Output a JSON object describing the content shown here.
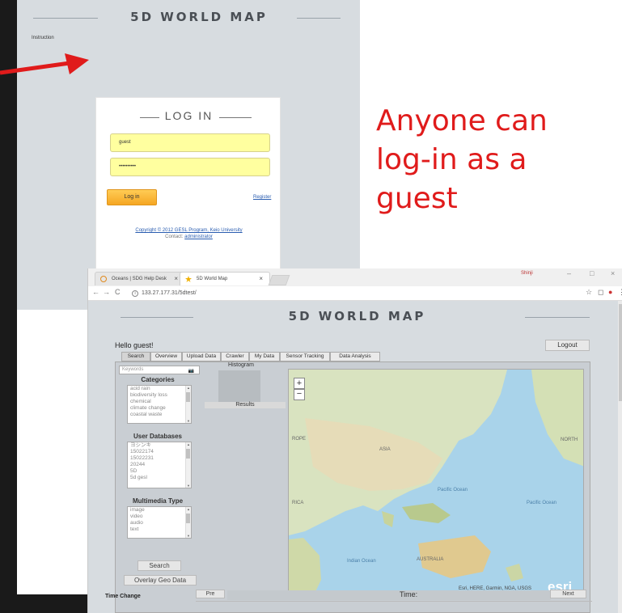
{
  "login_page": {
    "title": "5D WORLD MAP",
    "instruction": "Instruction",
    "heading": "LOG IN",
    "username_value": "guest",
    "password_value": "••••••••••",
    "login_button": "Log in",
    "register_link": "Register",
    "copyright": "Copyright © 2012  GESL Program, Keio University",
    "contact_label": "Contact:",
    "contact_link": "administrator"
  },
  "annotation": {
    "line1": "Anyone can",
    "line2": "log-in as a",
    "line3": "guest",
    "color": "#e01b1b"
  },
  "browser": {
    "tabs": [
      {
        "label": "Oceans | SDG Help Desk"
      },
      {
        "label": "5D World Map"
      }
    ],
    "url": "133.27.177.31/5dtest/",
    "window_user": "Shinji"
  },
  "app": {
    "title": "5D WORLD MAP",
    "greeting": "Hello guest!",
    "logout": "Logout",
    "tabs": [
      "Search",
      "Overview",
      "Upload Data",
      "Crawler",
      "My Data",
      "Sensor Tracking",
      "Data Analysis"
    ],
    "keywords_placeholder": "Keywords",
    "categories": {
      "heading": "Categories",
      "items": [
        "acid rain",
        "biodiversity loss",
        "chemical",
        "climate change",
        "coastal waste"
      ]
    },
    "user_databases": {
      "heading": "User Databases",
      "items": [
        "ヨシンキ",
        "15022174",
        "15022231",
        "20244",
        "5D",
        "5d gesl"
      ]
    },
    "multimedia_type": {
      "heading": "Multimedia Type",
      "items": [
        "image",
        "video",
        "audio",
        "text"
      ]
    },
    "search_button": "Search",
    "overlay_button": "Overlay Geo Data",
    "histogram_label": "Histogram",
    "results_label": "Results",
    "map": {
      "zoom_in": "+",
      "zoom_out": "−",
      "labels": [
        "ROPE",
        "ASIA",
        "NORTH",
        "Pacific Ocean",
        "Pacific Ocean",
        "RICA",
        "Indian Ocean",
        "AUSTRALIA"
      ],
      "attribution": "Esri, HERE, Garmin, NGA, USGS",
      "logo": "esri"
    },
    "time": {
      "change_label": "Time Change",
      "pre": "Pre",
      "label": "Time:",
      "next": "Next"
    }
  }
}
